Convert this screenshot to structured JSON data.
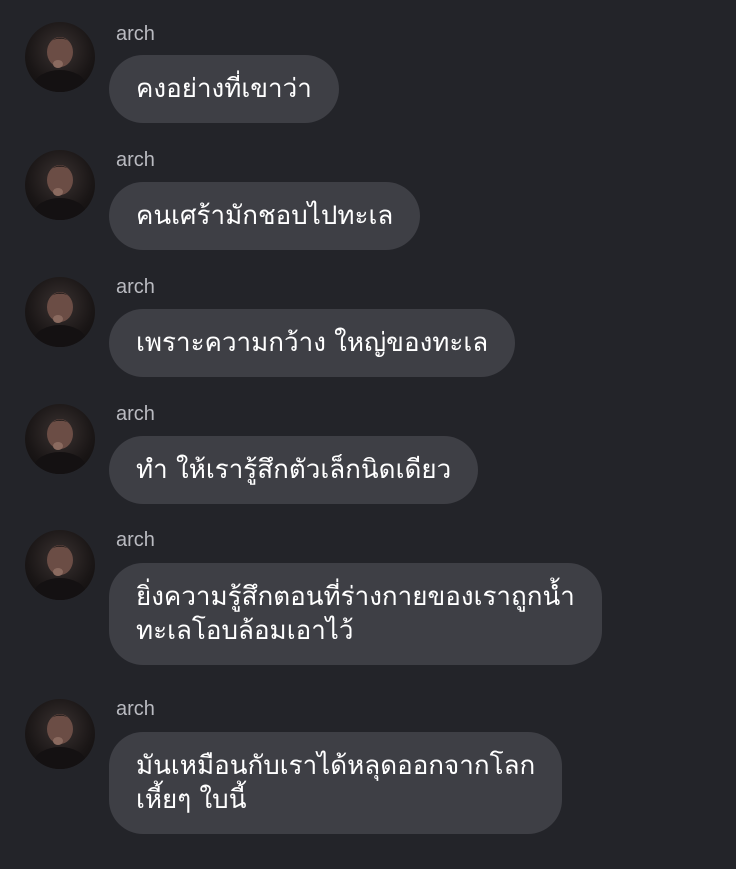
{
  "messages": [
    {
      "sender": "arch",
      "avatar": "user-avatar",
      "text": "คงอย่างที่เขาว่า"
    },
    {
      "sender": "arch",
      "avatar": "user-avatar",
      "text": "คนเศร้ามักชอบไปทะเล"
    },
    {
      "sender": "arch",
      "avatar": "user-avatar",
      "text": "เพราะความกว้าง ใหญ่ของทะเล"
    },
    {
      "sender": "arch",
      "avatar": "user-avatar",
      "text": "ทำ ให้เรารู้สึกตัวเล็กนิดเดียว"
    },
    {
      "sender": "arch",
      "avatar": "user-avatar",
      "text": "ยิ่งความรู้สึกตอนที่ร่างกายของเราถูกน้ำ\nทะเลโอบล้อมเอาไว้"
    },
    {
      "sender": "arch",
      "avatar": "user-avatar",
      "text": "มันเหมือนกับเราได้หลุดออกจากโลก\nเหี้ยๆ ใบนี้"
    }
  ],
  "colors": {
    "background": "#232429",
    "bubble": "#3e3f45",
    "message_text": "#ffffff",
    "sender_text": "#b9bac0"
  }
}
